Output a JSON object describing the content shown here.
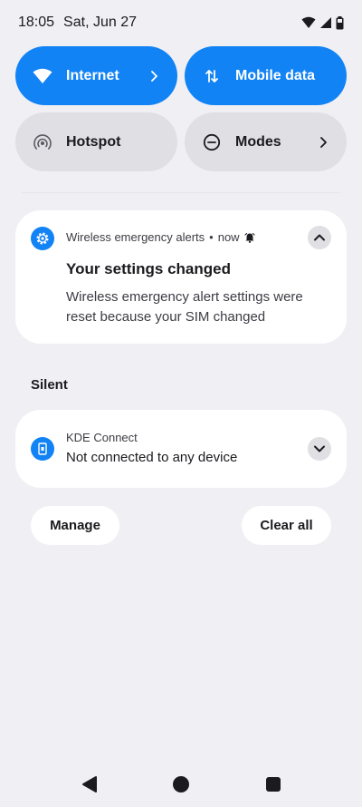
{
  "status_bar": {
    "time": "18:05",
    "date": "Sat, Jun 27"
  },
  "tiles": [
    {
      "label": "Internet",
      "icon": "wifi-icon",
      "active": true,
      "chevron": true
    },
    {
      "label": "Mobile data",
      "icon": "mobile-data-icon",
      "active": true,
      "chevron": false
    },
    {
      "label": "Hotspot",
      "icon": "hotspot-icon",
      "active": false,
      "chevron": false
    },
    {
      "label": "Modes",
      "icon": "modes-icon",
      "active": false,
      "chevron": true
    }
  ],
  "alert_notification": {
    "app": "Wireless emergency alerts",
    "separator": "•",
    "time": "now",
    "title": "Your settings changed",
    "body": "Wireless emergency alert settings were reset because your SIM changed"
  },
  "silent_section": {
    "label": "Silent"
  },
  "kde_notification": {
    "app": "KDE Connect",
    "text": "Not connected to any device"
  },
  "actions": {
    "manage": "Manage",
    "clear_all": "Clear all"
  },
  "colors": {
    "accent": "#1283f5",
    "background": "#f0f0f4",
    "card": "#ffffff",
    "inactive_tile": "#dfdfe4"
  }
}
